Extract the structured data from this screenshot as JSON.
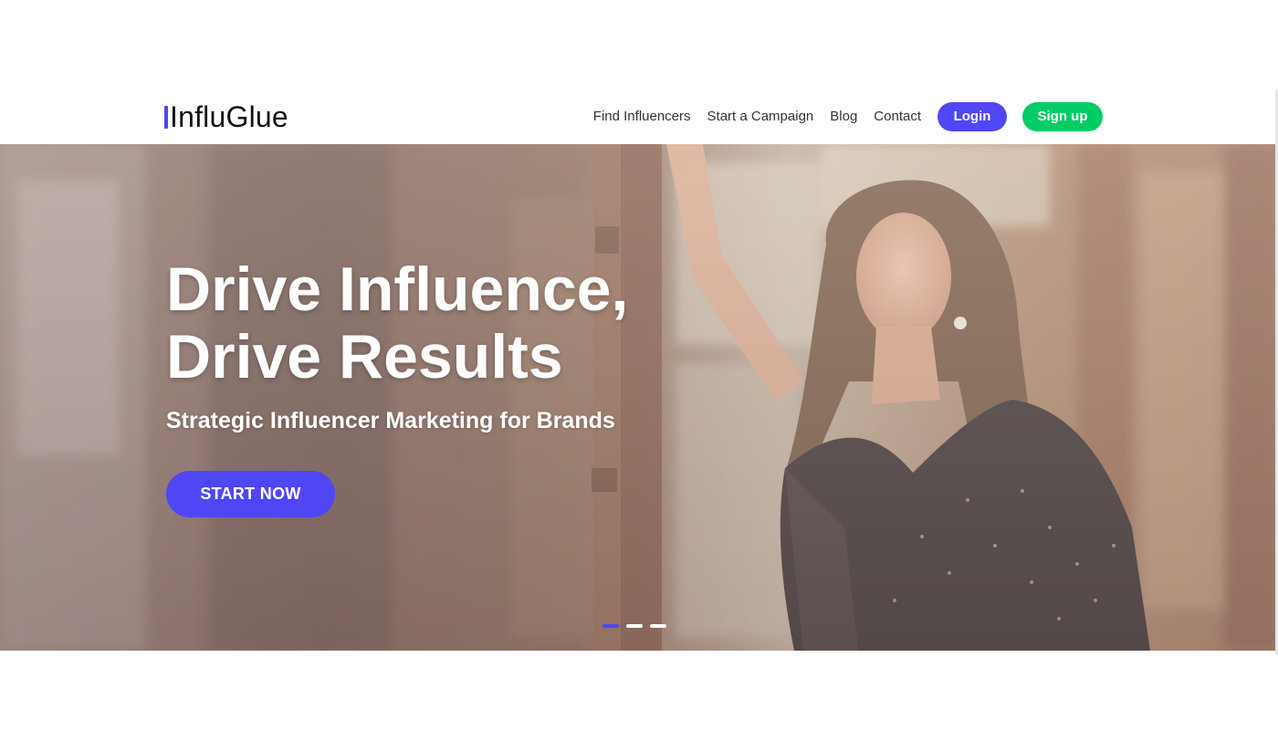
{
  "brand": {
    "name": "InfluGlue",
    "accent_color": "#5046f5",
    "secondary_color": "#00cc66"
  },
  "nav": {
    "links": [
      "Find Influencers",
      "Start a Campaign",
      "Blog",
      "Contact"
    ],
    "login_label": "Login",
    "signup_label": "Sign up"
  },
  "hero": {
    "title_line1": "Drive Influence,",
    "title_line2": "Drive Results",
    "subtitle": "Strategic Influencer Marketing for Brands",
    "cta_label": "START NOW",
    "slides_total": 3,
    "active_slide": 1,
    "background_description_icon": "woman-portrait-photo"
  }
}
